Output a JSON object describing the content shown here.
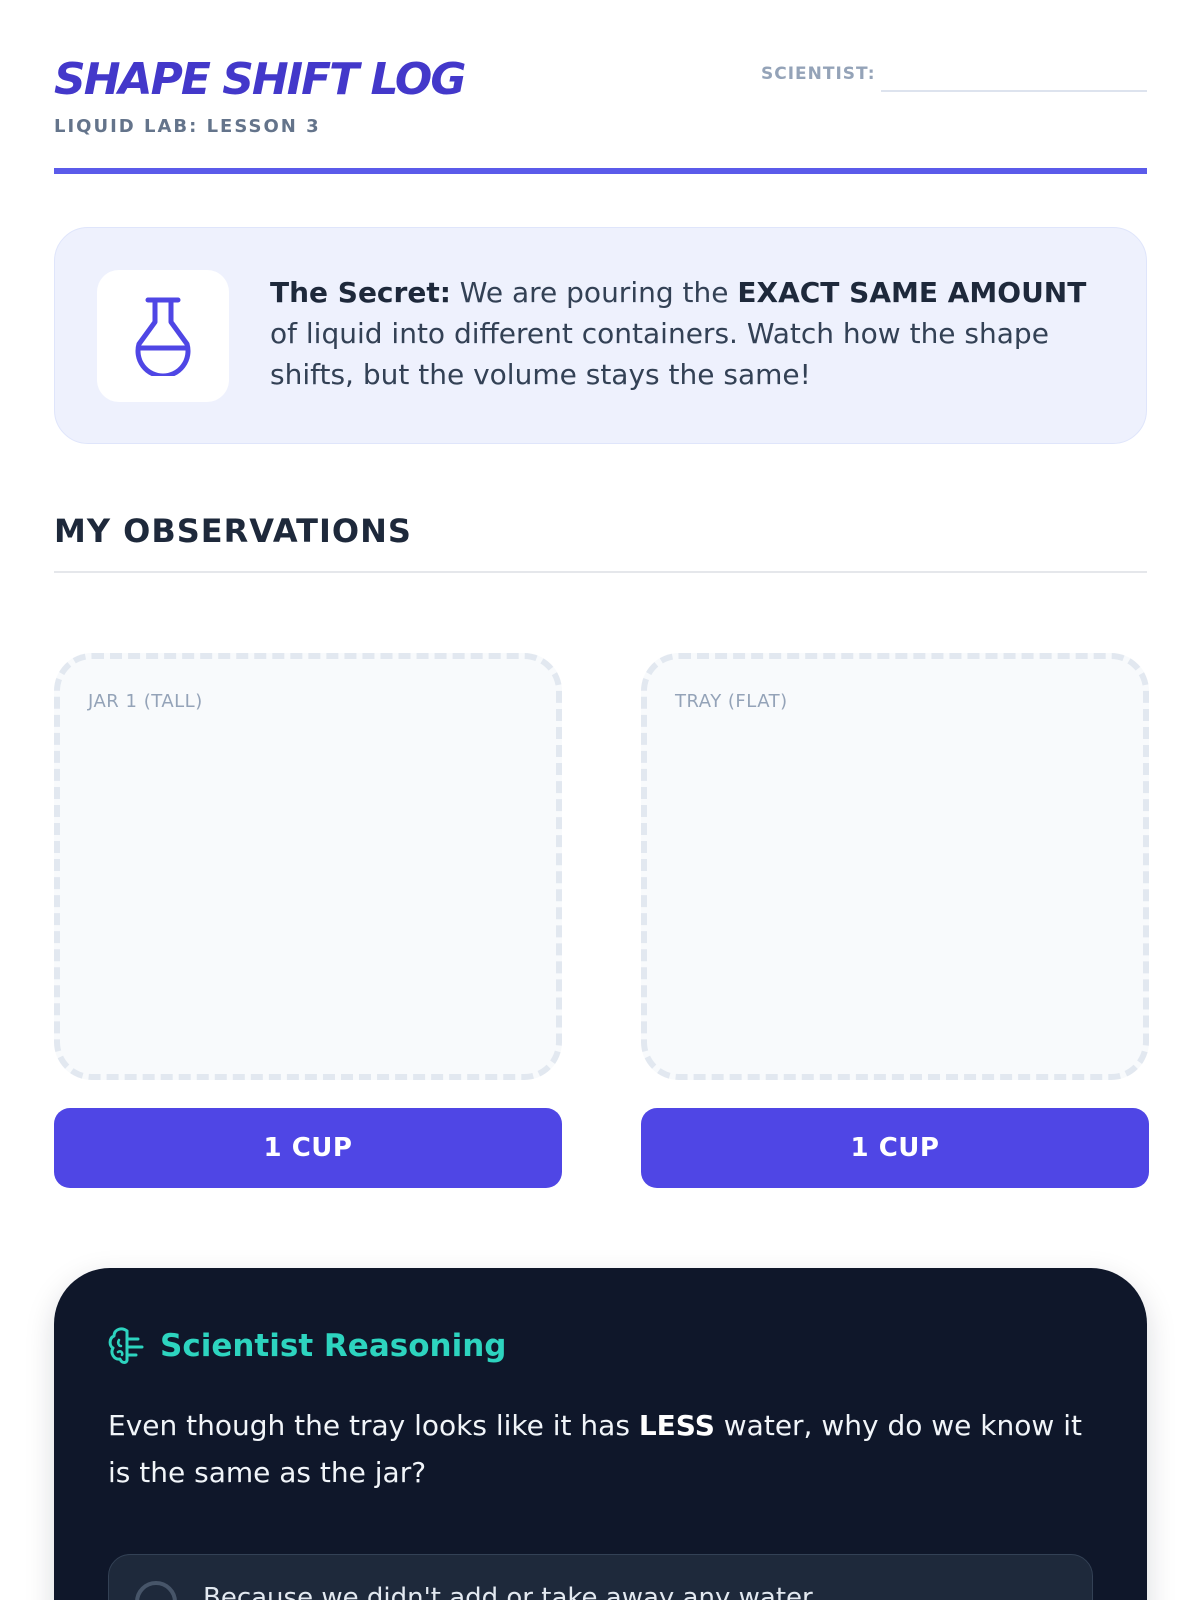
{
  "header": {
    "title": "SHAPE SHIFT LOG",
    "subtitle": "LIQUID LAB: LESSON 3",
    "scientist_label": "SCIENTIST:",
    "scientist_value": ""
  },
  "secret": {
    "icon": "flask-icon",
    "lead": "The Secret:",
    "text_1": " We are pouring the ",
    "emphasis": "EXACT SAME AMOUNT",
    "text_2": " of liquid into different containers. Watch how the shape shifts, but the volume stays the same!"
  },
  "observations": {
    "title": "MY OBSERVATIONS",
    "containers": [
      {
        "label": "JAR 1 (TALL)",
        "button": "1 CUP"
      },
      {
        "label": "TRAY (FLAT)",
        "button": "1 CUP"
      }
    ]
  },
  "reasoning": {
    "icon": "brain-icon",
    "title": "Scientist Reasoning",
    "question_1": "Even though the tray looks like it has ",
    "question_emphasis": "LESS",
    "question_2": " water, why do we know it is the same as the jar?",
    "options": [
      {
        "text": "Because we didn't add or take away any water."
      }
    ]
  },
  "colors": {
    "accent": "#4f46e5",
    "title": "#4338ca",
    "teal": "#2dd4bf",
    "dark_panel": "#0f172a"
  }
}
